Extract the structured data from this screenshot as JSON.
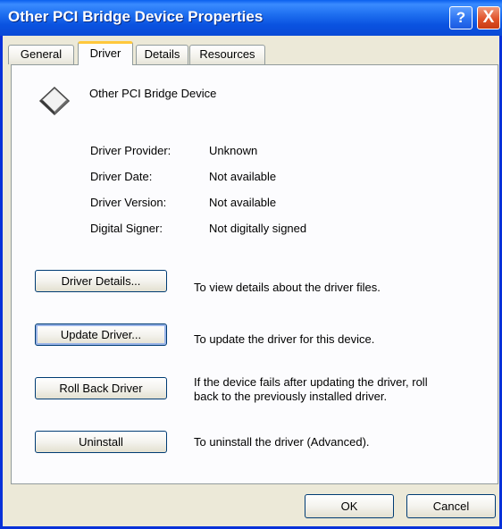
{
  "window": {
    "title": "Other PCI Bridge Device Properties",
    "help_glyph": "?",
    "close_glyph": "X"
  },
  "tabs": [
    {
      "label": "General"
    },
    {
      "label": "Driver",
      "active": true
    },
    {
      "label": "Details"
    },
    {
      "label": "Resources"
    }
  ],
  "device": {
    "name": "Other PCI Bridge Device",
    "icon": "pci-bridge-device-icon"
  },
  "info": {
    "provider_label": "Driver Provider:",
    "provider_value": "Unknown",
    "date_label": "Driver Date:",
    "date_value": "Not available",
    "version_label": "Driver Version:",
    "version_value": "Not available",
    "signer_label": "Digital Signer:",
    "signer_value": "Not digitally signed"
  },
  "actions": {
    "details_button": "Driver Details...",
    "details_desc": "To view details about the driver files.",
    "update_button": "Update Driver...",
    "update_desc": "To update the driver for this device.",
    "rollback_button": "Roll Back Driver",
    "rollback_desc_line1": "If the device fails after updating the driver, roll",
    "rollback_desc_line2": "back to the previously installed driver.",
    "uninstall_button": "Uninstall",
    "uninstall_desc": "To uninstall the driver (Advanced)."
  },
  "footer": {
    "ok_button": "OK",
    "cancel_button": "Cancel"
  },
  "colors": {
    "title_bar": "#0a52e0",
    "window_bg": "#ece9d8",
    "active_tab_accent": "#ffc83c",
    "close_button": "#e0532a"
  }
}
